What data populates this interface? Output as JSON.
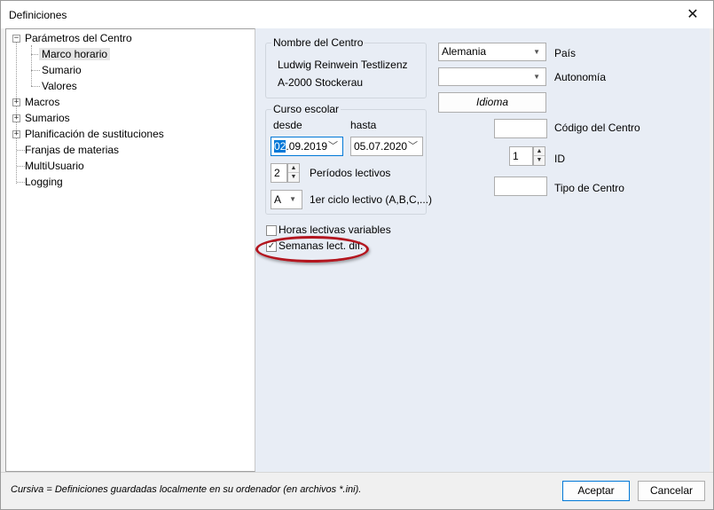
{
  "window": {
    "title": "Definiciones"
  },
  "tree": {
    "items": [
      {
        "label": "Parámetros del Centro",
        "expander": "−"
      },
      {
        "label": "Marco horario"
      },
      {
        "label": "Sumario"
      },
      {
        "label": "Valores"
      },
      {
        "label": "Macros",
        "expander": "+"
      },
      {
        "label": "Sumarios",
        "expander": "+"
      },
      {
        "label": "Planificación de sustituciones",
        "expander": "+"
      },
      {
        "label": "Franjas de materias"
      },
      {
        "label": "MultiUsuario"
      },
      {
        "label": "Logging"
      }
    ]
  },
  "school": {
    "group_title": "Nombre del Centro",
    "line1": "Ludwig Reinwein Testlizenz",
    "line2": "A-2000 Stockerau"
  },
  "right": {
    "country_value": "Alemania",
    "country_label": "País",
    "region_value": "",
    "region_label": "Autonomía",
    "language_button": "Idioma",
    "school_code_value": "",
    "school_code_label": "Código del Centro",
    "id_value": "1",
    "id_label": "ID",
    "school_type_value": "",
    "school_type_label": "Tipo de Centro"
  },
  "year": {
    "group_title": "Curso escolar",
    "from_label": "desde",
    "to_label": "hasta",
    "from_sel": "02",
    "from_rest": ".09.2019",
    "to_value": "05.07.2020",
    "periods_value": "2",
    "periods_label": "Períodos lectivos",
    "cycle_value": "A",
    "cycle_label": "1er ciclo lectivo (A,B,C,...)"
  },
  "options": {
    "variable_hours_label": "Horas lectivas variables",
    "variable_hours_checked": false,
    "diff_weeks_label": "Semanas lect. dif.",
    "diff_weeks_mark": "✓"
  },
  "status": {
    "text": "Cursiva = Definiciones guardadas localmente en su ordenador (en archivos *.ini)."
  },
  "footer": {
    "accept": "Aceptar",
    "cancel": "Cancelar"
  }
}
